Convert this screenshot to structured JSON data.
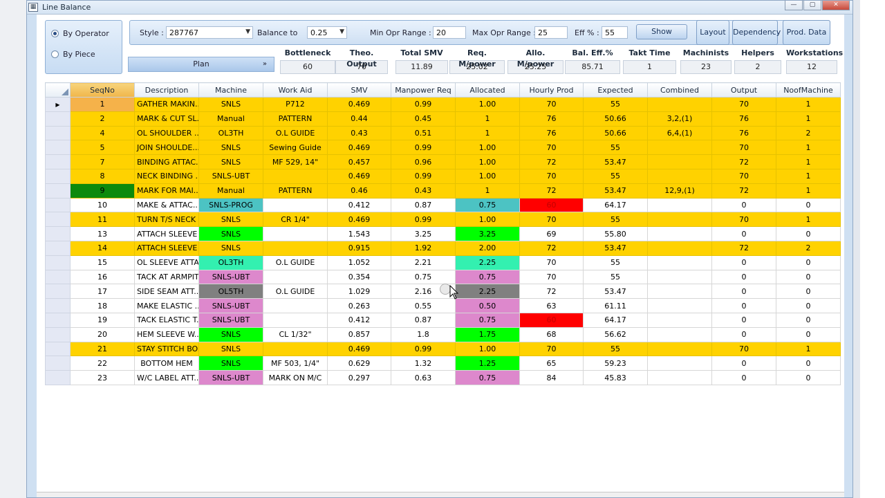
{
  "window": {
    "title": "Line Balance"
  },
  "mode": {
    "by_operator": "By Operator",
    "by_piece": "By Piece",
    "plan": "Plan"
  },
  "filters": {
    "style_label": "Style :",
    "style_value": "287767",
    "balance_label": "Balance to",
    "balance_value": "0.25",
    "min_label": "Min Opr Range :",
    "min_value": "20",
    "max_label": "Max Opr Range :",
    "max_value": "25",
    "eff_label": "Eff % :",
    "eff_value": "55",
    "show_button": "Show"
  },
  "toolbar": {
    "layout": "Layout",
    "dependency": "Dependency",
    "prod_data": "Prod. Data"
  },
  "stats": [
    {
      "label": "Bottleneck",
      "value": "60"
    },
    {
      "label": "Theo. Output",
      "value": "70"
    },
    {
      "label": "Total SMV",
      "value": "11.89"
    },
    {
      "label": "Req. M/power",
      "value": "25.02"
    },
    {
      "label": "Allo. M/power",
      "value": "25.25"
    },
    {
      "label": "Bal. Eff.%",
      "value": "85.71"
    },
    {
      "label": "Takt Time",
      "value": "1"
    },
    {
      "label": "Machinists",
      "value": "23"
    },
    {
      "label": "Helpers",
      "value": "2"
    },
    {
      "label": "Workstations",
      "value": "12"
    }
  ],
  "columns": [
    "SeqNo",
    "Description",
    "Machine",
    "Work Aid",
    "SMV",
    "Manpower Req",
    "Allocated",
    "Hourly Prod",
    "Expected",
    "Combined",
    "Output",
    "NoofMachine"
  ],
  "rows": [
    [
      "1",
      "GATHER MAKIN...",
      "SNLS",
      "P712",
      "0.469",
      "0.99",
      "1.00",
      "70",
      "55",
      "",
      "70",
      "1"
    ],
    [
      "2",
      "MARK & CUT SL...",
      "Manual",
      "PATTERN",
      "0.44",
      "0.45",
      "1",
      "76",
      "50.66",
      "3,2,(1)",
      "76",
      "1"
    ],
    [
      "4",
      "OL SHOULDER ...",
      "OL3TH",
      "O.L GUIDE",
      "0.43",
      "0.51",
      "1",
      "76",
      "50.66",
      "6,4,(1)",
      "76",
      "2"
    ],
    [
      "5",
      "JOIN SHOULDE...",
      "SNLS",
      "Sewing Guide",
      "0.469",
      "0.99",
      "1.00",
      "70",
      "55",
      "",
      "70",
      "1"
    ],
    [
      "7",
      "BINDING ATTAC...",
      "SNLS",
      "MF 529, 14\"",
      "0.457",
      "0.96",
      "1.00",
      "72",
      "53.47",
      "",
      "72",
      "1"
    ],
    [
      "8",
      "NECK BINDING ...",
      "SNLS-UBT",
      "",
      "0.469",
      "0.99",
      "1.00",
      "70",
      "55",
      "",
      "70",
      "1"
    ],
    [
      "9",
      "MARK FOR MAI...",
      "Manual",
      "PATTERN",
      "0.46",
      "0.43",
      "1",
      "72",
      "53.47",
      "12,9,(1)",
      "72",
      "1"
    ],
    [
      "10",
      "MAKE & ATTAC...",
      "SNLS-PROG",
      "",
      "0.412",
      "0.87",
      "0.75",
      "60",
      "64.17",
      "",
      "0",
      "0"
    ],
    [
      "11",
      "TURN T/S NECK ...",
      "SNLS",
      "CR 1/4\"",
      "0.469",
      "0.99",
      "1.00",
      "70",
      "55",
      "",
      "70",
      "1"
    ],
    [
      "13",
      "ATTACH SLEEVE ...",
      "SNLS",
      "",
      "1.543",
      "3.25",
      "3.25",
      "69",
      "55.80",
      "",
      "0",
      "0"
    ],
    [
      "14",
      "ATTACH SLEEVE ...",
      "SNLS",
      "",
      "0.915",
      "1.92",
      "2.00",
      "72",
      "53.47",
      "",
      "72",
      "2"
    ],
    [
      "15",
      "OL SLEEVE ATTA...",
      "OL3TH",
      "O.L GUIDE",
      "1.052",
      "2.21",
      "2.25",
      "70",
      "55",
      "",
      "0",
      "0"
    ],
    [
      "16",
      "TACK AT ARMPIT",
      "SNLS-UBT",
      "",
      "0.354",
      "0.75",
      "0.75",
      "70",
      "55",
      "",
      "0",
      "0"
    ],
    [
      "17",
      "SIDE SEAM ATT...",
      "OL5TH",
      "O.L GUIDE",
      "1.029",
      "2.16",
      "2.25",
      "72",
      "53.47",
      "",
      "0",
      "0"
    ],
    [
      "18",
      "MAKE ELASTIC ...",
      "SNLS-UBT",
      "",
      "0.263",
      "0.55",
      "0.50",
      "63",
      "61.11",
      "",
      "0",
      "0"
    ],
    [
      "19",
      "TACK ELASTIC T...",
      "SNLS-UBT",
      "",
      "0.412",
      "0.87",
      "0.75",
      "60",
      "64.17",
      "",
      "0",
      "0"
    ],
    [
      "20",
      "HEM SLEEVE W...",
      "SNLS",
      "CL 1/32\"",
      "0.857",
      "1.8",
      "1.75",
      "68",
      "56.62",
      "",
      "0",
      "0"
    ],
    [
      "21",
      "STAY STITCH BO...",
      "SNLS",
      "",
      "0.469",
      "0.99",
      "1.00",
      "70",
      "55",
      "",
      "70",
      "1"
    ],
    [
      "22",
      "BOTTOM HEM",
      "SNLS",
      "MF 503, 1/4\"",
      "0.629",
      "1.32",
      "1.25",
      "65",
      "59.23",
      "",
      "0",
      "0"
    ],
    [
      "23",
      "W/C LABEL ATT...",
      "SNLS-UBT",
      "MARK ON M/C",
      "0.297",
      "0.63",
      "0.75",
      "84",
      "45.83",
      "",
      "0",
      "0"
    ]
  ],
  "colors": {
    "yellow_row": "#ffd200",
    "green": "#00ff00",
    "teal": "#4cc3c3",
    "mint": "#33f0b0",
    "pink": "#dd88cc",
    "gray": "#808080",
    "red": "#ff0000",
    "dark_green": "#0c8a0c"
  }
}
